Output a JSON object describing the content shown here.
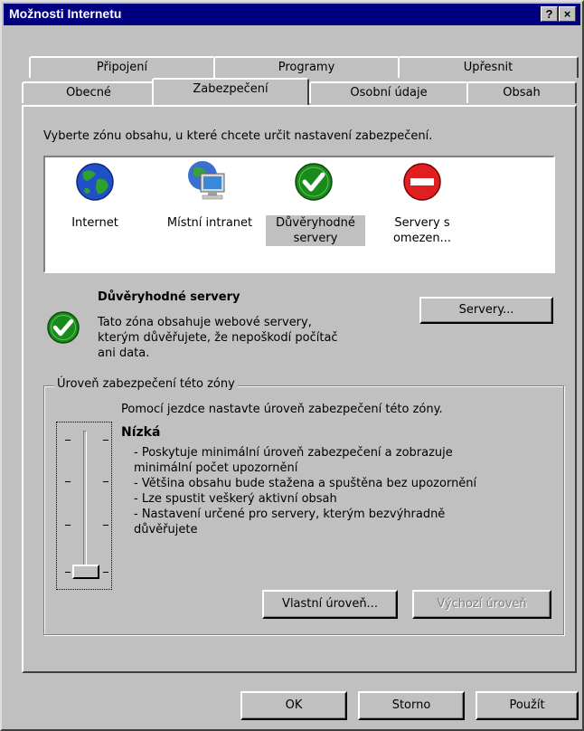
{
  "window": {
    "title": "Možnosti Internetu",
    "help_button": "?",
    "close_button": "×"
  },
  "tabs_back": [
    "Připojení",
    "Programy",
    "Upřesnit"
  ],
  "tabs_front": [
    "Obecné",
    "Zabezpečení",
    "Osobní údaje",
    "Obsah"
  ],
  "active_tab": "Zabezpečení",
  "instruction": "Vyberte zónu obsahu, u které chcete určit nastavení zabezpečení.",
  "zones": [
    {
      "icon": "globe-icon",
      "line1": "Internet",
      "line2": ""
    },
    {
      "icon": "computer-icon",
      "line1": "Místní intranet",
      "line2": ""
    },
    {
      "icon": "check-icon",
      "line1": "Důvěryhodné",
      "line2": "servery"
    },
    {
      "icon": "restricted-icon",
      "line1": "Servery s",
      "line2": "omezen..."
    }
  ],
  "selected_zone": {
    "title": "Důvěryhodné servery",
    "description": [
      "Tato zóna obsahuje webové servery,",
      "kterým důvěřujete, že nepoškodí počítač",
      "ani data."
    ],
    "servers_button": "Servery..."
  },
  "security_level": {
    "group_title": "Úroveň zabezpečení této zóny",
    "hint": "Pomocí jezdce nastavte úroveň zabezpečení této zóny.",
    "level_name": "Nízká",
    "level_position": "1 of 4 (lowest)",
    "details": [
      "- Poskytuje minimální úroveň zabezpečení a zobrazuje",
      "minimální počet upozornění",
      "- Většina obsahu bude stažena a spuštěna bez upozornění",
      "- Lze spustit veškerý aktivní obsah",
      "- Nastavení určené pro servery, kterým bezvýhradně",
      "důvěřujete"
    ],
    "custom_button": "Vlastní úroveň...",
    "default_button": "Výchozí úroveň"
  },
  "footer": {
    "ok": "OK",
    "cancel": "Storno",
    "apply": "Použít"
  },
  "colors": {
    "titlebar": "#000080",
    "face": "#c0c0c0",
    "check_green": "#1a8a1a",
    "restricted_red": "#e02020"
  }
}
